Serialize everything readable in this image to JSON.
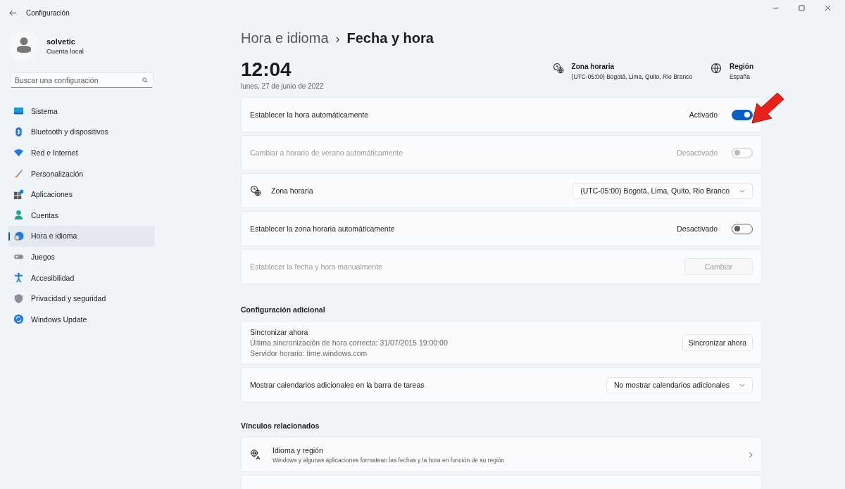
{
  "window": {
    "title": "Configuración"
  },
  "user": {
    "name": "solvetic",
    "account": "Cuenta local"
  },
  "search": {
    "placeholder": "Buscar una configuración"
  },
  "nav": [
    {
      "label": "Sistema",
      "selected": false
    },
    {
      "label": "Bluetooth y dispositivos",
      "selected": false
    },
    {
      "label": "Red e Internet",
      "selected": false
    },
    {
      "label": "Personalización",
      "selected": false
    },
    {
      "label": "Aplicaciones",
      "selected": false
    },
    {
      "label": "Cuentas",
      "selected": false
    },
    {
      "label": "Hora e idioma",
      "selected": true
    },
    {
      "label": "Juegos",
      "selected": false
    },
    {
      "label": "Accesibilidad",
      "selected": false
    },
    {
      "label": "Privacidad y seguridad",
      "selected": false
    },
    {
      "label": "Windows Update",
      "selected": false
    }
  ],
  "breadcrumb": {
    "parent": "Hora e idioma",
    "separator": "›",
    "current": "Fecha y hora"
  },
  "clock": {
    "time": "12:04",
    "date": "lunes, 27 de junio de 2022"
  },
  "summary": [
    {
      "label": "Zona horaria",
      "value": "(UTC-05:00) Bogotá, Lima, Quito, Rio Branco"
    },
    {
      "label": "Región",
      "value": "España"
    }
  ],
  "rows": [
    {
      "kind": "toggle",
      "label": "Establecer la hora automáticamente",
      "state_text": "Activado",
      "on": true,
      "disabled": false
    },
    {
      "kind": "toggle",
      "label": "Cambiar a horario de verano automáticamente",
      "state_text": "Desactivado",
      "on": false,
      "disabled": true
    },
    {
      "kind": "dropdown",
      "label": "Zona horaria",
      "value": "(UTC-05:00) Bogotá, Lima, Quito, Rio Branco",
      "disabled": false
    },
    {
      "kind": "toggle",
      "label": "Establecer la zona horaria automáticamente",
      "state_text": "Desactivado",
      "on": false,
      "disabled": false
    },
    {
      "kind": "button",
      "label": "Establecer la fecha y hora manualmente",
      "button": "Cambiar",
      "disabled": true
    }
  ],
  "additional": {
    "heading": "Configuración adicional",
    "rows": [
      {
        "kind": "sync",
        "label": "Sincronizar ahora",
        "lines": [
          "Última sincronización de hora correcta: 31/07/2015 19:00:00",
          "Servidor horario: time.windows.com"
        ],
        "button": "Sincronizar ahora"
      },
      {
        "kind": "dropdown",
        "label": "Mostrar calendarios adicionales en la barra de tareas",
        "value": "No mostrar calendarios adicionales"
      }
    ]
  },
  "related": {
    "heading": "Vínculos relacionados",
    "links": [
      {
        "title": "Idioma y región",
        "description": "Windows y algunas aplicaciones formatean las fechas y la hora en función de su región"
      }
    ]
  }
}
